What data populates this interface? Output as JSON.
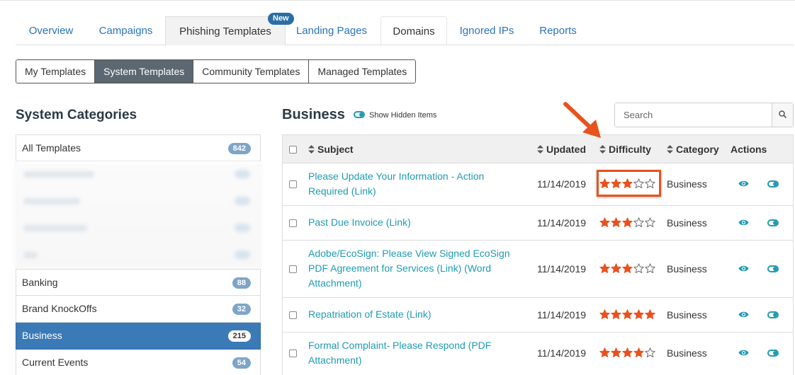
{
  "main_tabs": [
    {
      "label": "Overview"
    },
    {
      "label": "Campaigns"
    },
    {
      "label": "Phishing Templates",
      "badge": "New"
    },
    {
      "label": "Landing Pages"
    },
    {
      "label": "Domains"
    },
    {
      "label": "Ignored IPs"
    },
    {
      "label": "Reports"
    }
  ],
  "sub_tabs": [
    {
      "label": "My Templates"
    },
    {
      "label": "System Templates"
    },
    {
      "label": "Community Templates"
    },
    {
      "label": "Managed Templates"
    }
  ],
  "sidebar": {
    "title": "System Categories",
    "items": [
      {
        "label": "All Templates",
        "count": "842"
      },
      {
        "label": "Banking",
        "count": "88"
      },
      {
        "label": "Brand KnockOffs",
        "count": "32"
      },
      {
        "label": "Business",
        "count": "215",
        "active": true
      },
      {
        "label": "Current Events",
        "count": "54"
      }
    ]
  },
  "main": {
    "title": "Business",
    "show_hidden_label": "Show Hidden Items",
    "search_placeholder": "Search"
  },
  "table": {
    "headers": {
      "subject": "Subject",
      "updated": "Updated",
      "difficulty": "Difficulty",
      "category": "Category",
      "actions": "Actions"
    },
    "rows": [
      {
        "subject": "Please Update Your Information - Action Required (Link)",
        "updated": "11/14/2019",
        "difficulty": 3,
        "category": "Business"
      },
      {
        "subject": "Past Due Invoice (Link)",
        "updated": "11/14/2019",
        "difficulty": 3,
        "category": "Business"
      },
      {
        "subject": "Adobe/EcoSign: Please View Signed EcoSign PDF Agreement for Services (Link) (Word Attachment)",
        "updated": "11/14/2019",
        "difficulty": 3,
        "category": "Business"
      },
      {
        "subject": "Repatriation of Estate (Link)",
        "updated": "11/14/2019",
        "difficulty": 5,
        "category": "Business"
      },
      {
        "subject": "Formal Complaint- Please Respond (PDF Attachment)",
        "updated": "11/14/2019",
        "difficulty": 4,
        "category": "Business"
      }
    ]
  },
  "colors": {
    "link": "#1f9bb0",
    "star": "#e8521e",
    "active_category": "#3a7ab6",
    "highlight": "#e8521e"
  },
  "icons": {
    "search": "search-icon",
    "view": "eye-icon",
    "toggle": "toggle-icon",
    "sort": "sort-icon",
    "star_filled": "star-filled-icon",
    "star_empty": "star-empty-icon",
    "annotation_arrow": "arrow-icon"
  }
}
